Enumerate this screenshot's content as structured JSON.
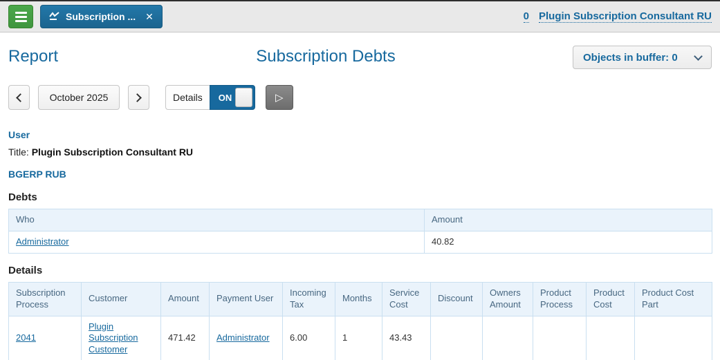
{
  "topbar": {
    "tab_label": "Subscription ...",
    "buffer_count": "0",
    "user_name": "Plugin Subscription Consultant RU"
  },
  "icons": {
    "close": "✕",
    "play": "▷"
  },
  "header": {
    "report_label": "Report",
    "title": "Subscription Debts",
    "buffer_label": "Objects in buffer: 0"
  },
  "toolbar": {
    "month": "October 2025",
    "details_label": "Details",
    "toggle_state": "ON"
  },
  "user_section": {
    "heading": "User",
    "title_label": "Title:",
    "title_value": "Plugin Subscription Consultant RU"
  },
  "currency_heading": "BGERP RUB",
  "debts": {
    "heading": "Debts",
    "columns": [
      "Who",
      "Amount"
    ],
    "rows": [
      {
        "who": "Administrator",
        "amount": "40.82"
      }
    ]
  },
  "details": {
    "heading": "Details",
    "columns": [
      "Subscription Process",
      "Customer",
      "Amount",
      "Payment User",
      "Incoming Tax",
      "Months",
      "Service Cost",
      "Discount",
      "Owners Amount",
      "Product Process",
      "Product Cost",
      "Product Cost Part"
    ],
    "rows": [
      {
        "subscription_process": "2041",
        "customer": "Plugin Subscription Customer",
        "amount": "471.42",
        "payment_user": "Administrator",
        "incoming_tax": "6.00",
        "months": "1",
        "service_cost": "43.43",
        "discount": "",
        "owners_amount": "",
        "product_process": "",
        "product_cost": "",
        "product_cost_part": ""
      }
    ]
  },
  "colors": {
    "accent_blue": "#17699e",
    "tab_blue": "#1e6e9c",
    "menu_green": "#43a047",
    "table_header_bg": "#eaf3fb",
    "table_border": "#c9dff0",
    "topbar_bg": "#e9e9e9"
  }
}
